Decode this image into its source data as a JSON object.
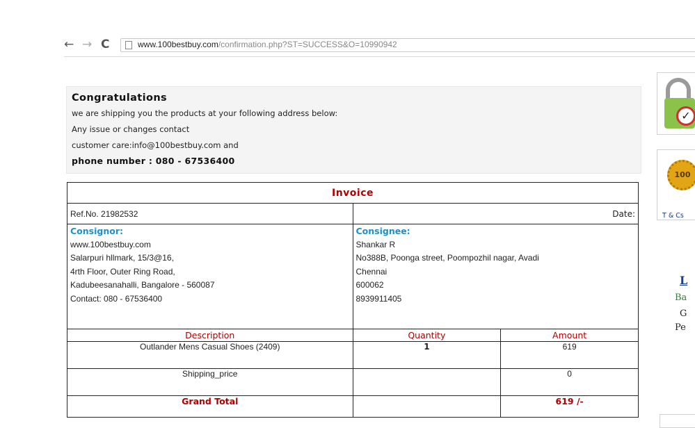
{
  "browser": {
    "back_icon": "←",
    "forward_icon": "→",
    "reload_icon": "C",
    "url_host": "www.100bestbuy.com",
    "url_path": "/confirmation.php?ST=SUCCESS&O=10990942"
  },
  "message": {
    "heading": "Congratulations",
    "line1": "we are shipping you the products at your following address below:",
    "line2": "Any issue or changes contact",
    "line3": "customer care:info@100bestbuy.com and",
    "phone": "phone number : 080 - 67536400"
  },
  "invoice": {
    "title": "Invoice",
    "ref": "Ref.No. 21982532",
    "date_label": "Date:",
    "consignor": {
      "label": "Consignor:",
      "lines": [
        "www.100bestbuy.com",
        "Salarpuri hllmark, 15/3@16,",
        "4rth Floor, Outer Ring Road,",
        "Kadubeesanahalli, Bangalore - 560087",
        "Contact: 080 - 67536400"
      ]
    },
    "consignee": {
      "label": "Consignee:",
      "lines": [
        "Shankar R",
        "No388B, Poonga street, Poompozhil nagar, Avadi",
        "Chennai",
        "600062",
        "8939911405"
      ]
    },
    "headers": {
      "description": "Description",
      "quantity": "Quantity",
      "amount": "Amount"
    },
    "items": [
      {
        "description": "Outlander Mens Casual Shoes (2409)",
        "quantity": "1",
        "amount": "619"
      },
      {
        "description": "Shipping_price",
        "quantity": "",
        "amount": "0"
      }
    ],
    "total": {
      "label": "Grand Total",
      "amount": "619 /-"
    }
  },
  "sidebar": {
    "lock_check": "✓",
    "seal_text": "100",
    "tcs_link": "T & Cs",
    "link_L": "L",
    "text_Ba": "Ba",
    "text_G": "G",
    "text_Pe": "Pe"
  }
}
